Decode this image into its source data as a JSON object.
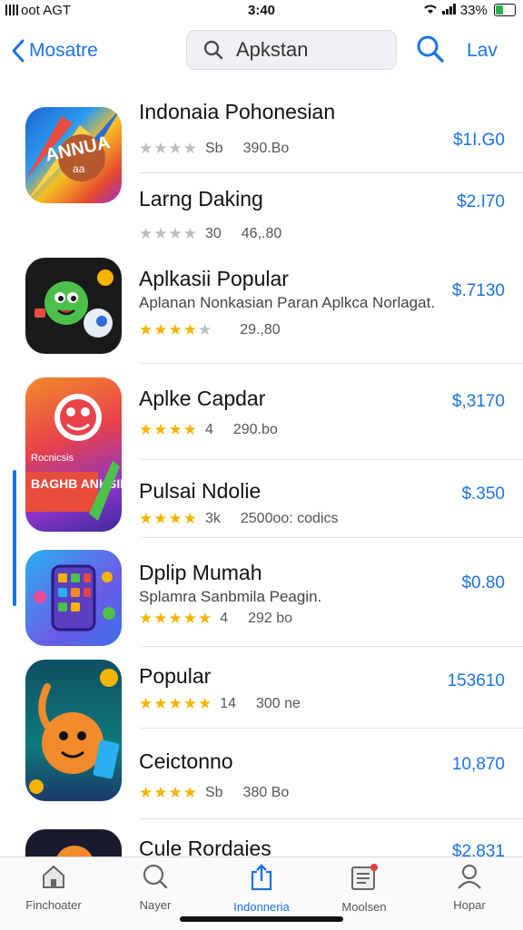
{
  "status": {
    "carrier": "oot AGT",
    "time": "3:40",
    "battery": "33%"
  },
  "nav": {
    "back_label": "Mosatre",
    "search_text": "Apkstan",
    "right_label": "Lav"
  },
  "apps": [
    {
      "name": "Indonaia Pohonesian",
      "subtitle": "",
      "rating": 3,
      "rating_count": "Sb",
      "downloads": "390.Bo",
      "price": "$1I.G0",
      "star_color": "gray"
    },
    {
      "name": "Larng Daking",
      "subtitle": "",
      "rating": 3,
      "rating_count": "30",
      "downloads": "46,.80",
      "price": "$2.I70",
      "star_color": "gray"
    },
    {
      "name": "Aplkasii Popular",
      "subtitle": "Aplanan Nonkasian Paran Aplkca Norlagat.",
      "rating": 4,
      "rating_count": "",
      "downloads": "29.,80",
      "price": "$.7130",
      "star_color": "gold"
    },
    {
      "name": "Aplke Capdar",
      "subtitle": "",
      "rating": 4,
      "rating_count": "4",
      "downloads": "290.bo",
      "price": "$,3170",
      "star_color": "gold"
    },
    {
      "name": "Pulsai Ndolie",
      "subtitle": "",
      "rating": 4,
      "rating_count": "3k",
      "downloads": "2500oo: codics",
      "price": "$.350",
      "star_color": "gold"
    },
    {
      "name": "Dplip Mumah",
      "subtitle": "Splamra Sanbmila Peagin.",
      "rating": 5,
      "rating_count": "4",
      "downloads": "292 bo",
      "price": "$0.80",
      "star_color": "gold"
    },
    {
      "name": "Popular",
      "subtitle": "",
      "rating": 5,
      "rating_count": "14",
      "downloads": "300 ne",
      "price": "153610",
      "star_color": "gold"
    },
    {
      "name": "Ceictonno",
      "subtitle": "",
      "rating": 4,
      "rating_count": "Sb",
      "downloads": "380 Bo",
      "price": "10,870",
      "star_color": "gold"
    },
    {
      "name": "Cule Rordaies",
      "subtitle": "",
      "rating": 0,
      "rating_count": "",
      "downloads": "",
      "price": "$2.831",
      "star_color": "gold"
    }
  ],
  "icon_text": {
    "icon1": "ANNUA",
    "icon1_small": "aa",
    "icon3_banner": "Rocnicsis",
    "icon3_big": "BAGHB ANKSIE"
  },
  "tabs": [
    {
      "label": "Finchoater",
      "icon": "home-icon"
    },
    {
      "label": "Nayer",
      "icon": "search-icon"
    },
    {
      "label": "Indonneria",
      "icon": "share-icon"
    },
    {
      "label": "Moolsen",
      "icon": "news-icon"
    },
    {
      "label": "Hopar",
      "icon": "person-icon"
    }
  ],
  "colors": {
    "accent": "#1a73e8",
    "star": "#f5b400"
  }
}
